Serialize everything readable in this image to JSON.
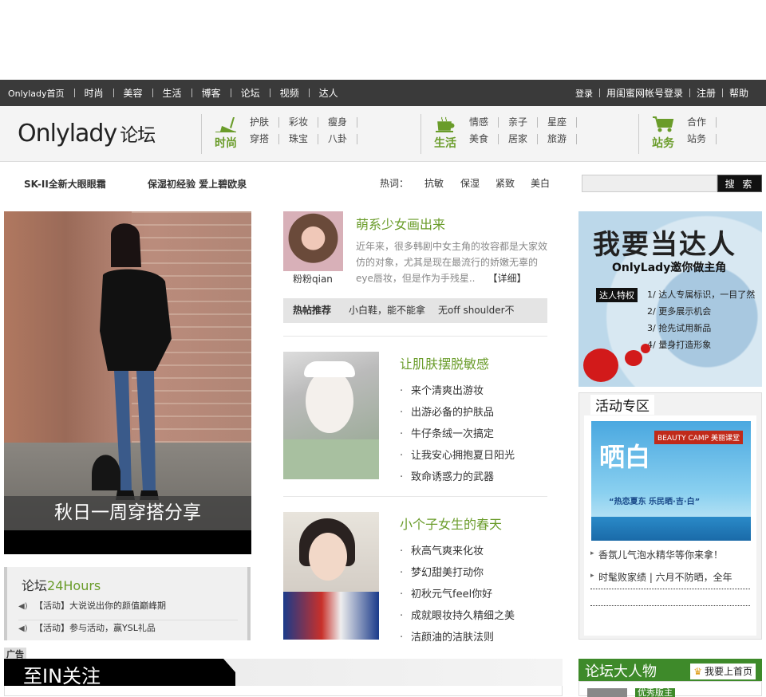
{
  "topnav": {
    "left": [
      "Onlylady首页",
      "时尚",
      "美容",
      "生活",
      "博客",
      "论坛",
      "视频",
      "达人"
    ],
    "right": [
      "登录",
      "用闺蜜网帐号登录",
      "注册",
      "帮助"
    ]
  },
  "logo": {
    "en": "Onlylady",
    "cn": "论坛"
  },
  "categories": [
    {
      "name": "时尚",
      "links": [
        "护肤",
        "穿搭",
        "彩妆",
        "珠宝",
        "瘦身",
        "八卦"
      ]
    },
    {
      "name": "生活",
      "links": [
        "情感",
        "美食",
        "亲子",
        "居家",
        "星座",
        "旅游"
      ]
    },
    {
      "name": "站务",
      "links": [
        "合作",
        "站务"
      ]
    }
  ],
  "hotrow": {
    "promo1": "SK-II全新大眼眼霜",
    "promo2": "保湿初经验 爱上碧欧泉",
    "hot_label": "热词：",
    "hot_words": [
      "抗敏",
      "保湿",
      "紧致",
      "美白"
    ],
    "search_button": "搜 索",
    "search_placeholder": ""
  },
  "feature": {
    "caption": "秋日一周穿搭分享"
  },
  "hours24": {
    "title_prefix": "论坛",
    "title_highlight": "24Hours",
    "items": [
      "【活动】大说说出你的颜值巅峰期",
      "【活动】参与活动，赢YSL礼品"
    ]
  },
  "ad_label": "广告",
  "article1": {
    "author": "粉粉qian",
    "title": "萌系少女画出来",
    "text": "近年来，很多韩剧中女主角的妆容都是大家效仿的对象，尤其是现在最流行的娇嫩无辜的eye唇妆，但是作为手残星..",
    "more": "【详细】"
  },
  "hotbar": {
    "label": "热帖推荐",
    "items": [
      "小白鞋，能不能拿",
      "无off shoulder不"
    ]
  },
  "list1": {
    "title": "让肌肤摆脱敏感",
    "items": [
      "来个清爽出游妆",
      "出游必备的护肤品",
      "牛仔条绒一次搞定",
      "让我安心拥抱夏日阳光",
      "致命诱惑力的武器"
    ]
  },
  "list2": {
    "title": "小个子女生的春天",
    "items": [
      "秋高气爽来化妆",
      "梦幻甜美打动你",
      "初秋元气feel你好",
      "成就眼妆持久精细之美",
      "洁颜油的洁肤法则"
    ]
  },
  "daren": {
    "big": "我要当达人",
    "invite": "OnlyLady邀你做主角",
    "priv_label": "达人特权",
    "privileges": [
      "1/ 达人专属标识，一目了然",
      "2/ 更多展示机会",
      "3/ 抢先试用新品",
      "4/ 量身打造形象"
    ]
  },
  "events": {
    "title": "活动专区",
    "banner_big": "晒白",
    "banner_tag": "BEAUTY CAMP 美丽课堂",
    "banner_text": "“热恋夏东 乐民晒·吉·白”",
    "items": [
      "香氛儿气泡水精华等你来拿！",
      "时髦败家绩 | 六月不防晒，全年"
    ]
  },
  "zhiin": {
    "title": "至IN关注"
  },
  "people": {
    "title": "论坛大人物",
    "up": "我要上首页",
    "tag": "优秀版主"
  }
}
